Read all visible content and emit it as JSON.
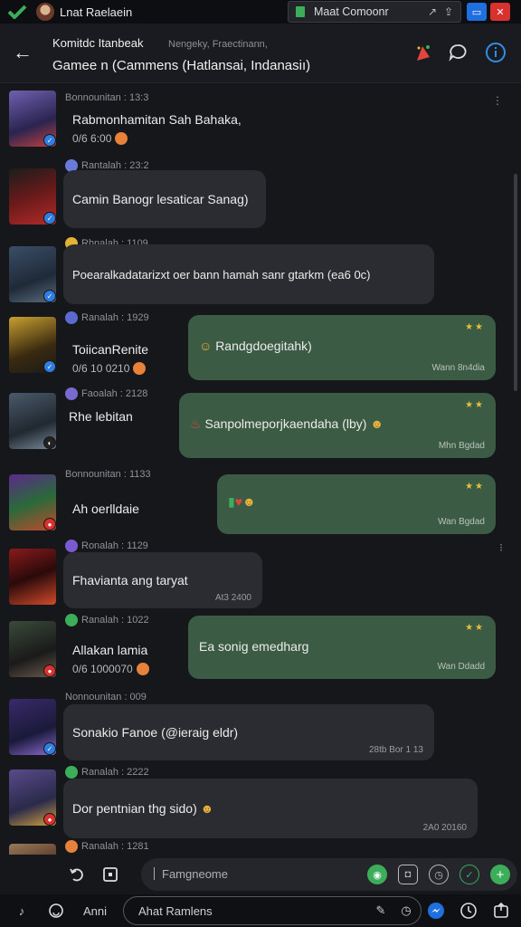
{
  "topbar": {
    "title": "Lnat Raelaein",
    "window_box": "Maat Comoonr",
    "icons": [
      "whatsapp-logo-icon",
      "avatar",
      "doc-icon",
      "pin-icon",
      "share-icon",
      "window-icon",
      "close-icon"
    ]
  },
  "header": {
    "title_line1": "Komitdc Itanbeak",
    "subtitle": "Nengeky, Fraectinann,",
    "title_line2": "Gamee n (Cammens (Hatlansai, Indanasiı)",
    "icons": [
      "back-arrow-icon",
      "celebrate-icon",
      "chat-bubble-icon",
      "info-icon"
    ]
  },
  "messages": [
    {
      "meta": "Bonnounitan : 13:3",
      "text": "Rabmonhamitan Sah Bahaka,",
      "sub": "0/6   6:00"
    },
    {
      "meta": "Rantalah : 23:2",
      "text": "Camin Banogr lesaticar Sanag)"
    },
    {
      "meta": "Rhnalah : 1109",
      "text": "Poearalkadatarizxt oer bann hamah sanr gtarkm (ea6 0c)"
    },
    {
      "meta": "Ranalah : 1929",
      "text": "ToiicanRenite",
      "sub": "0/6  10 0210",
      "sent_text": "Randgdoegitahk)",
      "sent_time": "Wann 8n4dia"
    },
    {
      "meta": "Faoalah : 2128",
      "text": "Rhe lebitan",
      "sent_text": "Sanpolmeporjkaendaha (lby)",
      "sent_time": "Mhn Bgdad"
    },
    {
      "meta": "Bonnounitan : 1133",
      "text": "Ah oerlldaie",
      "sent_text": "",
      "sent_time": "Wan Bgdad"
    },
    {
      "meta": "Ronalah : 1129",
      "text": "Fhavianta ang taryat",
      "time": "At3 2400"
    },
    {
      "meta": "Ranalah : 1022",
      "text": "Allakan lamia",
      "sub": "0/6   1000070",
      "sent_text": "Ea sonig emedharg",
      "sent_time": "Wan Ddadd"
    },
    {
      "meta": "Nonnounitan : 009",
      "text": "Sonakio Fanoe (@ieraig eldr)",
      "time": "28tb Bor 1 13"
    },
    {
      "meta": "Ranalah : 2222",
      "text": "Dor pentnian thg sido)",
      "time": "2A0 20160"
    },
    {
      "meta": "Ranalah : 1281"
    }
  ],
  "compose": {
    "placeholder": "Famgneome",
    "icons": [
      "repost-icon",
      "layout-icon",
      "whatsapp-icon",
      "camera-icon",
      "clock-icon",
      "shield-icon",
      "add-icon"
    ]
  },
  "bottom": {
    "label": "Anni",
    "input_text": "Ahat Ramlens",
    "icons": [
      "tiktok-icon",
      "emoji-icon",
      "mic-icon",
      "timer-icon",
      "messenger-icon",
      "clock-icon",
      "share-icon"
    ]
  },
  "colors": {
    "background": "#16171b",
    "received_bubble": "#2b2c31",
    "sent_bubble": "#3b5b44",
    "accent_green": "#3cae5a",
    "accent_blue": "#1f6fe0"
  }
}
